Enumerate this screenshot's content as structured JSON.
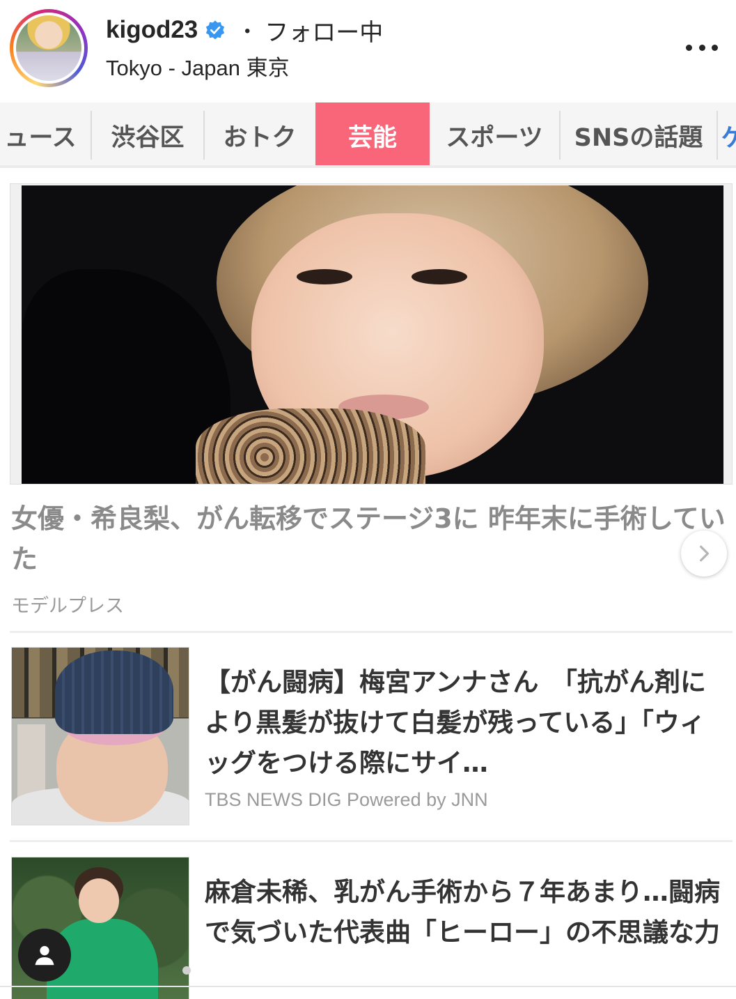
{
  "post_header": {
    "username": "kigod23",
    "follow_separator": "・",
    "follow_status": "フォロー中",
    "location": "Tokyo - Japan 東京",
    "verified_icon": "verified-badge-icon",
    "more_icon": "more-horizontal-icon"
  },
  "tabs": [
    {
      "label": "ュース",
      "active": false
    },
    {
      "label": "渋谷区",
      "active": false
    },
    {
      "label": "おトク",
      "active": false
    },
    {
      "label": "芸能",
      "active": true
    },
    {
      "label": "スポーツ",
      "active": false
    },
    {
      "label": "SNSの話題",
      "active": false
    },
    {
      "label": "ゲ",
      "active": false
    }
  ],
  "hero": {
    "title": "女優・希良梨、がん転移でステージ3に 昨年末に手術していた",
    "source": "モデルプレス",
    "next_icon": "chevron-right-icon"
  },
  "articles": [
    {
      "title": "【がん闘病】梅宮アンナさん　「抗がん剤により黒髪が抜けて白髪が残っている」「ウィッグをつける際にサイ…",
      "source": "TBS NEWS DIG Powered by JNN"
    },
    {
      "title": "麻倉未稀、乳がん手術から７年あまり…闘病で気づいた代表曲「ヒーロー」の不思議な力",
      "source": ""
    }
  ],
  "fab_icon": "profile-person-icon",
  "colors": {
    "active_tab": "#f9667a",
    "verified": "#3897f0",
    "text_primary": "#262626",
    "text_muted": "#9a9a9a"
  }
}
